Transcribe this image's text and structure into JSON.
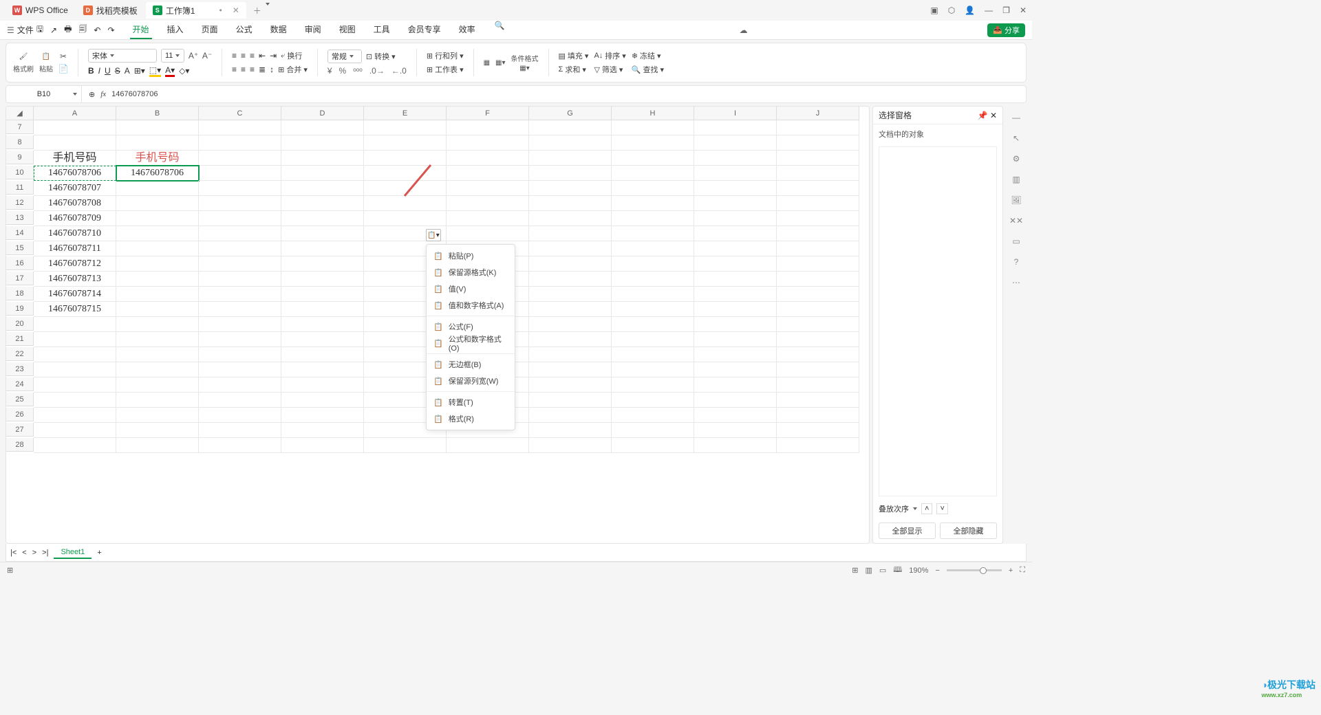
{
  "title_tabs": [
    "WPS Office",
    "找稻壳模板",
    "工作簿1"
  ],
  "win_controls": [
    "▢",
    "⬡",
    "👤",
    "—",
    "▢",
    "✕"
  ],
  "file_menu": "文件",
  "ribbon_tabs": [
    "开始",
    "插入",
    "页面",
    "公式",
    "数据",
    "审阅",
    "视图",
    "工具",
    "会员专享",
    "效率"
  ],
  "share": "分享",
  "font": {
    "name": "宋体",
    "size": "11"
  },
  "ribbon": {
    "fmt": "格式刷",
    "paste": "粘贴",
    "brow": [
      "B",
      "I",
      "U",
      "S"
    ],
    "num": "常规",
    "conv": "转换",
    "rowcol": "行和列",
    "ws": "工作表",
    "cond": "条件格式",
    "fill": "填充",
    "sort": "排序",
    "freeze": "冻结",
    "sum": "求和",
    "filter": "筛选",
    "find": "查找",
    "merge": "合并",
    "wrap": "换行"
  },
  "namebox": "B10",
  "formula": "14676078706",
  "cols": [
    "A",
    "B",
    "C",
    "D",
    "E",
    "F",
    "G",
    "H",
    "I",
    "J"
  ],
  "row_start": 7,
  "row_end": 28,
  "cells": {
    "A9": "手机号码",
    "B9": "手机号码",
    "B10": "14676078706",
    "A10": "14676078706",
    "A11": "14676078707",
    "A12": "14676078708",
    "A13": "14676078709",
    "A14": "14676078710",
    "A15": "14676078711",
    "A16": "14676078712",
    "A17": "14676078713",
    "A18": "14676078714",
    "A19": "14676078715"
  },
  "ctx": [
    "粘贴(P)",
    "保留源格式(K)",
    "值(V)",
    "值和数字格式(A)",
    "公式(F)",
    "公式和数字格式(O)",
    "无边框(B)",
    "保留源列宽(W)",
    "转置(T)",
    "格式(R)"
  ],
  "side": {
    "title": "选择窗格",
    "sub": "文档中的对象",
    "stack": "叠放次序",
    "all": "全部显示",
    "hide": "全部隐藏"
  },
  "sheet_tab": "Sheet1",
  "zoom": "190%",
  "logo": "极光下载站",
  "logo_url": "www.xz7.com"
}
